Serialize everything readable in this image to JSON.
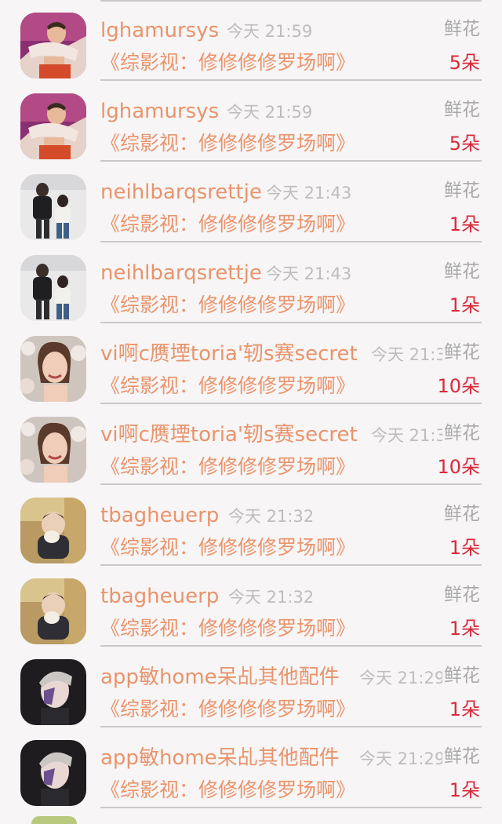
{
  "items": [
    {
      "name": "lghamursys",
      "time": "今天 21:59",
      "gift": "鲜花",
      "book": "《综影视：修修修修罗场啊》",
      "count": "5朵",
      "avatar_icon": "avatar-lghamursys"
    },
    {
      "name": "lghamursys",
      "time": "今天 21:59",
      "gift": "鲜花",
      "book": "《综影视：修修修修罗场啊》",
      "count": "5朵",
      "avatar_icon": "avatar-lghamursys"
    },
    {
      "name": "neihlbarqsrettje",
      "time": "今天 21:43",
      "gift": "鲜花",
      "book": "《综影视：修修修修罗场啊》",
      "count": "1朵",
      "avatar_icon": "avatar-neihlbarqsrettje"
    },
    {
      "name": "neihlbarqsrettje",
      "time": "今天 21:43",
      "gift": "鲜花",
      "book": "《综影视：修修修修罗场啊》",
      "count": "1朵",
      "avatar_icon": "avatar-neihlbarqsrettje"
    },
    {
      "name": "vi啊c赝堙toria'轫s赛secret",
      "time": "今天 21:39",
      "gift": "鲜花",
      "book": "《综影视：修修修修罗场啊》",
      "count": "10朵",
      "avatar_icon": "avatar-victoria-secret"
    },
    {
      "name": "vi啊c赝堙toria'轫s赛secret",
      "time": "今天 21:39",
      "gift": "鲜花",
      "book": "《综影视：修修修修罗场啊》",
      "count": "10朵",
      "avatar_icon": "avatar-victoria-secret"
    },
    {
      "name": "tbagheuerp",
      "time": "今天 21:32",
      "gift": "鲜花",
      "book": "《综影视：修修修修罗场啊》",
      "count": "1朵",
      "avatar_icon": "avatar-tbagheuerp"
    },
    {
      "name": "tbagheuerp",
      "time": "今天 21:32",
      "gift": "鲜花",
      "book": "《综影视：修修修修罗场啊》",
      "count": "1朵",
      "avatar_icon": "avatar-tbagheuerp"
    },
    {
      "name": "app敏home呆乩其他配件",
      "time": "今天 21:29",
      "gift": "鲜花",
      "book": "《综影视：修修修修罗场啊》",
      "count": "1朵",
      "avatar_icon": "avatar-app-home"
    },
    {
      "name": "app敏home呆乩其他配件",
      "time": "今天 21:29",
      "gift": "鲜花",
      "book": "《综影视：修修修修罗场啊》",
      "count": "1朵",
      "avatar_icon": "avatar-app-home"
    }
  ]
}
